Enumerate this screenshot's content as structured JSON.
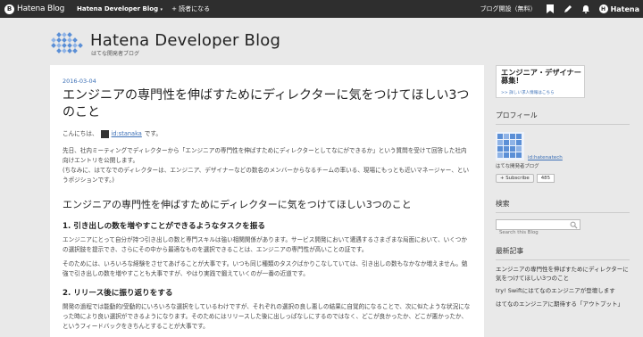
{
  "topbar": {
    "logo_text": "Hatena Blog",
    "blog_menu": "Hatena Developer Blog",
    "reader_button": "+ 読者になる",
    "start_blog": "ブログ開設（無料）",
    "hatena_label": "Hatena"
  },
  "header": {
    "title": "Hatena Developer Blog",
    "subtitle": "はてな開発者ブログ"
  },
  "article": {
    "date": "2016-03-04",
    "title": "エンジニアの専門性を伸ばすためにディレクターに気をつけてほしい3つのこと",
    "greeting_before": "こんにちは、",
    "greeting_user": "id:stanaka",
    "greeting_after": "です。",
    "intro_1": "先日、社内ミーティングでディレクターから「エンジニアの専門性を伸ばすためにディレクターとしてなにができるか」という質問を受けて回答した社内向けエントリを公開します。",
    "intro_2": "(ちなみに、はてなでのディレクターは、エンジニア、デザイナーなどの数名のメンバーからなるチームの率いる、現場にもっとも近いマネージャー、というポジションです。)",
    "section_heading": "エンジニアの専門性を伸ばすためにディレクターに気をつけてほしい3つのこと",
    "point1_heading": "1. 引き出しの数を増やすことができるようなタスクを振る",
    "point1_p1": "エンジニアにとって自分が持つ引き出しの数と専門スキルは強い相関関係があります。サービス開発において遭遇するさまざまな局面において、いくつかの選択肢を提示でき、さらにその中から最適なものを選択できることは、エンジニアの専門性が高いことの証です。",
    "point1_p2": "そのためには、いろいろな経験をさせてあげることが大事です。いつも同じ種類のタスクばかりこなしていては、引き出しの数もなかなか増えません。勉強で引き出しの数を増やすことも大事ですが、やはり実践で鍛えていくのが一番の近道です。",
    "point2_heading": "2. リリース後に振り返りをする",
    "point2_p1": "開発の過程では能動的/受動的にいろいろな選択をしているわけですが、それぞれの選択の良し悪しの結果に自覚的になることで、次に似たような状況になった時により良い選択ができるようになります。そのためにはリリースした後に出しっぱなしにするのではなく、どこが良かったか、どこが悪かったか、というフィードバックをきちんとすることが大事です。"
  },
  "sidebar": {
    "ad_title": "エンジニア・デザイナー募集！",
    "ad_link": ">> 詳しい求人情報はこちら",
    "profile_title": "プロフィール",
    "profile_id": "id:hatenatech",
    "profile_name": "はてな開発者ブログ",
    "subscribe_label": "+ Subscribe",
    "subscribe_count": "485",
    "search_title": "検索",
    "search_placeholder": "Search this Blog",
    "recent_title": "最新記事",
    "recent": [
      "エンジニアの専門性を伸ばすためにディレクターに気をつけてほしい3つのこと",
      "try! Swiftにはてなのエンジニアが登壇します",
      "はてなのエンジニアに期待する「アウトプット」"
    ]
  },
  "colors": {
    "topbar_bg": "#2e2e2e",
    "page_bg": "#e9e9e9",
    "link": "#3b6fb6",
    "logo_blue": "#5b8fd6"
  }
}
